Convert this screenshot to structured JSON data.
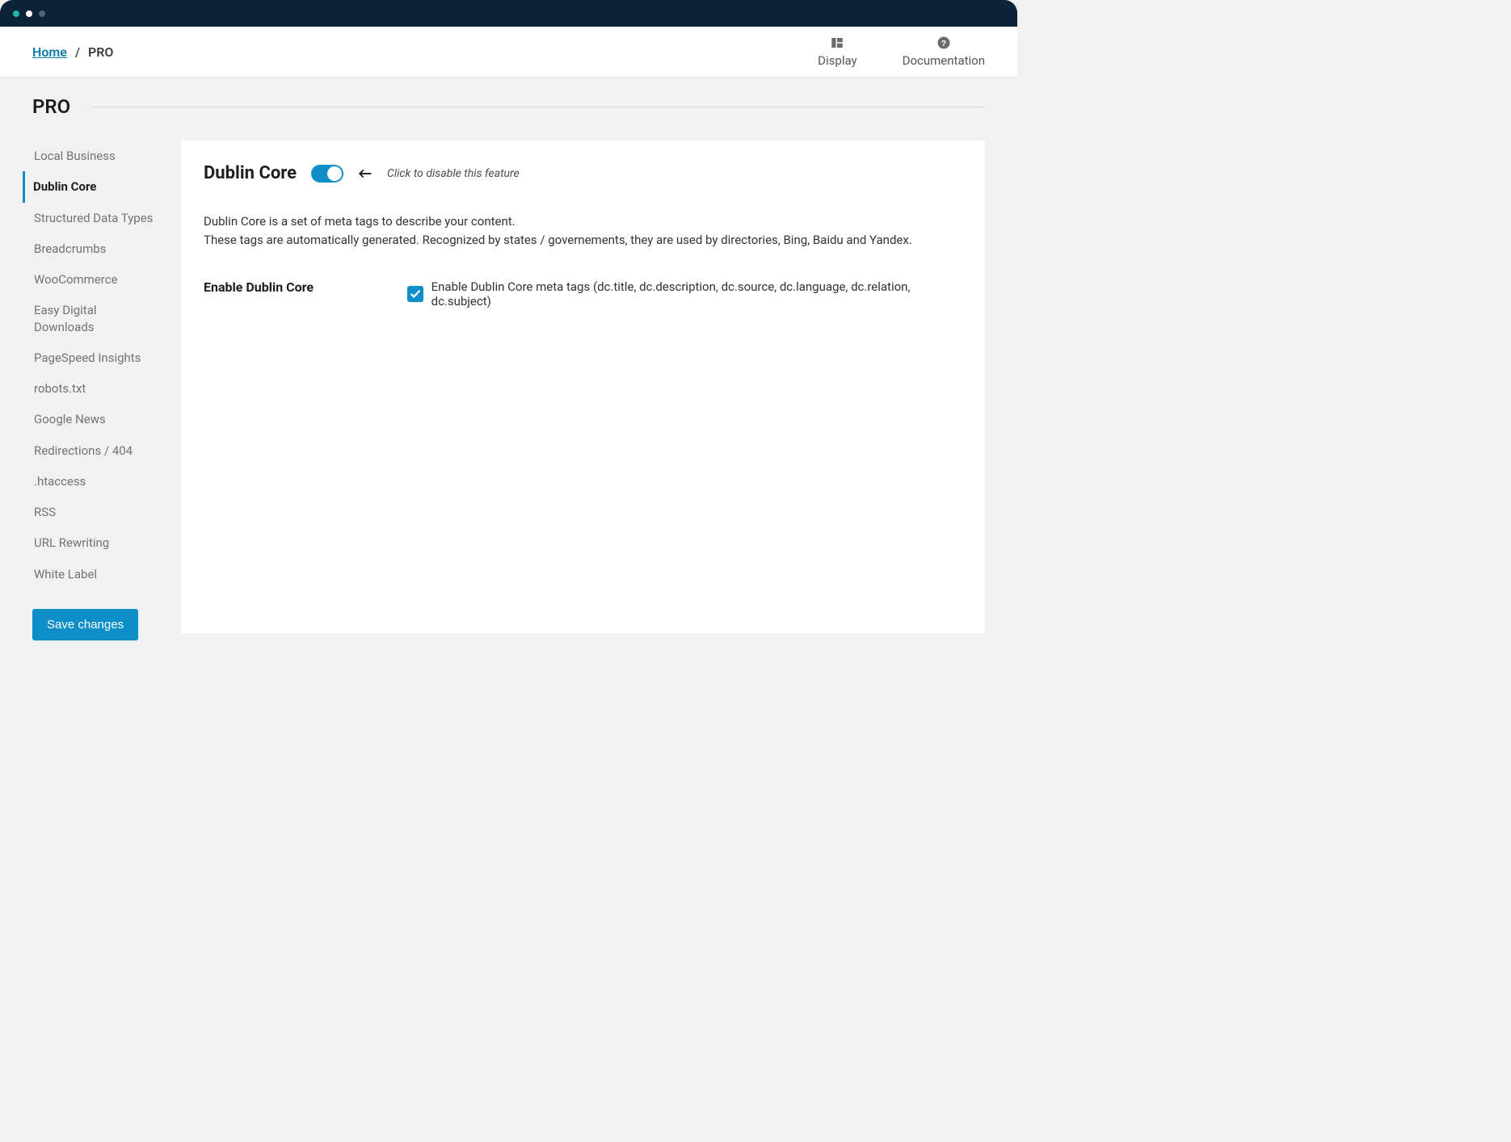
{
  "breadcrumb": {
    "home": "Home",
    "current": "PRO"
  },
  "header_actions": {
    "display": "Display",
    "documentation": "Documentation"
  },
  "page_title": "PRO",
  "sidebar": {
    "items": [
      {
        "label": "Local Business",
        "active": false
      },
      {
        "label": "Dublin Core",
        "active": true
      },
      {
        "label": "Structured Data Types",
        "active": false
      },
      {
        "label": "Breadcrumbs",
        "active": false
      },
      {
        "label": "WooCommerce",
        "active": false
      },
      {
        "label": "Easy Digital Downloads",
        "active": false
      },
      {
        "label": "PageSpeed Insights",
        "active": false
      },
      {
        "label": "robots.txt",
        "active": false
      },
      {
        "label": "Google News",
        "active": false
      },
      {
        "label": "Redirections / 404",
        "active": false
      },
      {
        "label": ".htaccess",
        "active": false
      },
      {
        "label": "RSS",
        "active": false
      },
      {
        "label": "URL Rewriting",
        "active": false
      },
      {
        "label": "White Label",
        "active": false
      }
    ],
    "save_button": "Save changes"
  },
  "panel": {
    "title": "Dublin Core",
    "toggle_on": true,
    "hint": "Click to disable this feature",
    "desc_line1": "Dublin Core is a set of meta tags to describe your content.",
    "desc_line2": "These tags are automatically generated. Recognized by states / governements, they are used by directories, Bing, Baidu and Yandex.",
    "option_label": "Enable Dublin Core",
    "option_checked": true,
    "option_text": "Enable Dublin Core meta tags (dc.title, dc.description, dc.source, dc.language, dc.relation, dc.subject)"
  }
}
